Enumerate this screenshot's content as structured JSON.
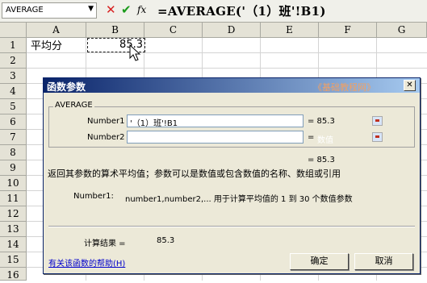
{
  "formula_bar": {
    "name_box": "AVERAGE",
    "cancel_glyph": "✕",
    "enter_glyph": "✔",
    "fx_label": "fx",
    "formula": "=AVERAGE('（1）班'!B1)"
  },
  "sheet": {
    "columns": [
      "A",
      "B",
      "C",
      "D",
      "E",
      "F",
      "G"
    ],
    "rows": [
      "1",
      "2",
      "3",
      "4",
      "5",
      "6",
      "7",
      "8",
      "9",
      "10",
      "11",
      "12",
      "13",
      "14",
      "15",
      "16"
    ],
    "cell_a1": "平均分",
    "cell_b1": "85.3"
  },
  "dialog": {
    "title": "函数参数",
    "watermark": "《基础教程网》",
    "close_glyph": "✕",
    "group_label": "AVERAGE",
    "number1_label": "Number1",
    "number1_value": "'（1）班'!B1",
    "number1_result": "= 85.3",
    "number2_label": "Number2",
    "number2_placeholder": "",
    "number2_result_eq": "=",
    "number2_result_hint": "数值",
    "total_result": "= 85.3",
    "description": "返回其参数的算术平均值；参数可以是数值或包含数值的名称、数组或引用",
    "param_name": "Number1:",
    "param_desc": "number1,number2,... 用于计算平均值的 1 到 30 个数值参数",
    "calc_label": "计算结果 =",
    "calc_value": "85.3",
    "help_link": "有关该函数的帮助(H)",
    "ok_button": "确定",
    "cancel_button": "取消"
  },
  "colors": {
    "title_start": "#0a246a",
    "title_end": "#a6caf0",
    "dialog_bg": "#ece9d8",
    "header_bg": "#e4e2d6",
    "hint_text": "#ffffff"
  }
}
